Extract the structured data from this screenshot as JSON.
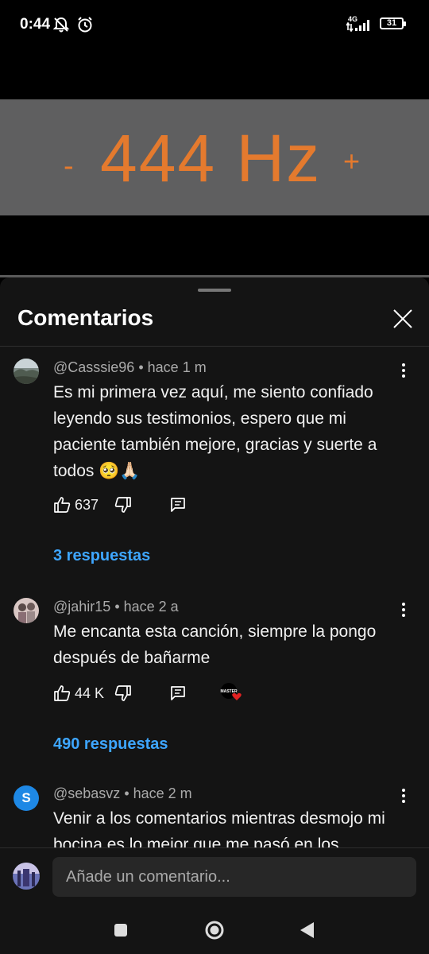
{
  "status_bar": {
    "time": "0:44",
    "network": "4G",
    "battery": "31",
    "icons": [
      "notifications-off-icon",
      "alarm-icon",
      "signal-icon",
      "battery-icon"
    ]
  },
  "video": {
    "minus": "-",
    "frequency": "444 Hz",
    "plus": "+",
    "text_color": "#e47a2e",
    "background": "#5f5f60"
  },
  "panel": {
    "title": "Comentarios",
    "close_icon": "close-icon"
  },
  "comments": [
    {
      "author": "@Casssie96",
      "time": "hace 1 m",
      "text": "Es mi primera vez aquí, me siento confiado leyendo sus testimonios, espero que mi paciente también mejore, gracias y suerte a todos 🥺🙏🏻",
      "likes": "637",
      "replies": "3 respuestas"
    },
    {
      "author": "@jahir15",
      "time": "hace 2 a",
      "text": "Me encanta esta canción, siempre la pongo después de bañarme",
      "likes": "44 K",
      "replies": "490 respuestas",
      "creator_badge": "MASTER"
    },
    {
      "author": "@sebasvz",
      "time": "hace 2 m",
      "avatar_letter": "S",
      "text": "Venir a los comentarios mientras desmojo mi bocina es lo mejor que me pasó en los"
    }
  ],
  "input": {
    "placeholder": "Añade un comentario..."
  },
  "colors": {
    "link": "#3ea6ff",
    "panel_bg": "#141414",
    "secondary_text": "#aaaaaa"
  }
}
